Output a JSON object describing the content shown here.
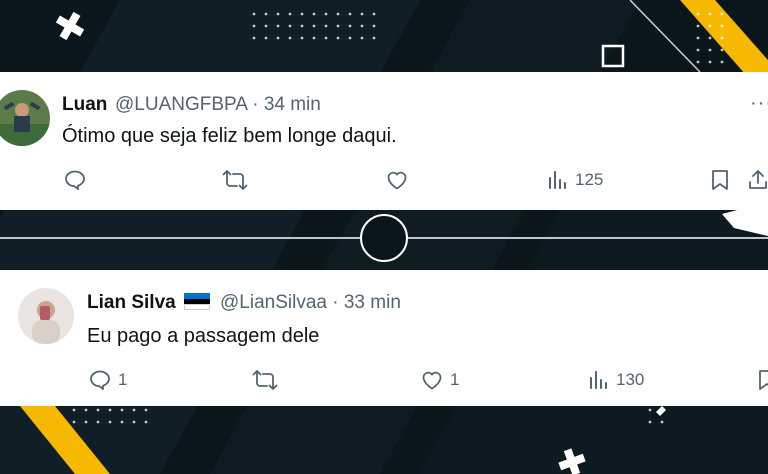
{
  "colors": {
    "background": "#0b161c",
    "accent": "#f6b800",
    "text_primary": "#0f1419",
    "text_secondary": "#536471"
  },
  "tweets": [
    {
      "name": "Luan",
      "handle": "@LUANGFBPA",
      "separator": "·",
      "time": "34 min",
      "text": "Ótimo que seja feliz bem longe daqui.",
      "more_label": "···",
      "replies": "",
      "retweets": "",
      "likes": "",
      "views": "125",
      "icons": [
        "reply-icon",
        "retweet-icon",
        "like-icon",
        "views-icon",
        "bookmark-icon",
        "share-icon"
      ]
    },
    {
      "name": "Lian Silva",
      "flag": "estonia-flag",
      "handle": "@LianSilvaa",
      "separator": "·",
      "time": "33 min",
      "text": "Eu pago a passagem dele",
      "replies": "1",
      "retweets": "",
      "likes": "1",
      "views": "130",
      "icons": [
        "reply-icon",
        "retweet-icon",
        "like-icon",
        "views-icon",
        "bookmark-icon"
      ]
    }
  ]
}
